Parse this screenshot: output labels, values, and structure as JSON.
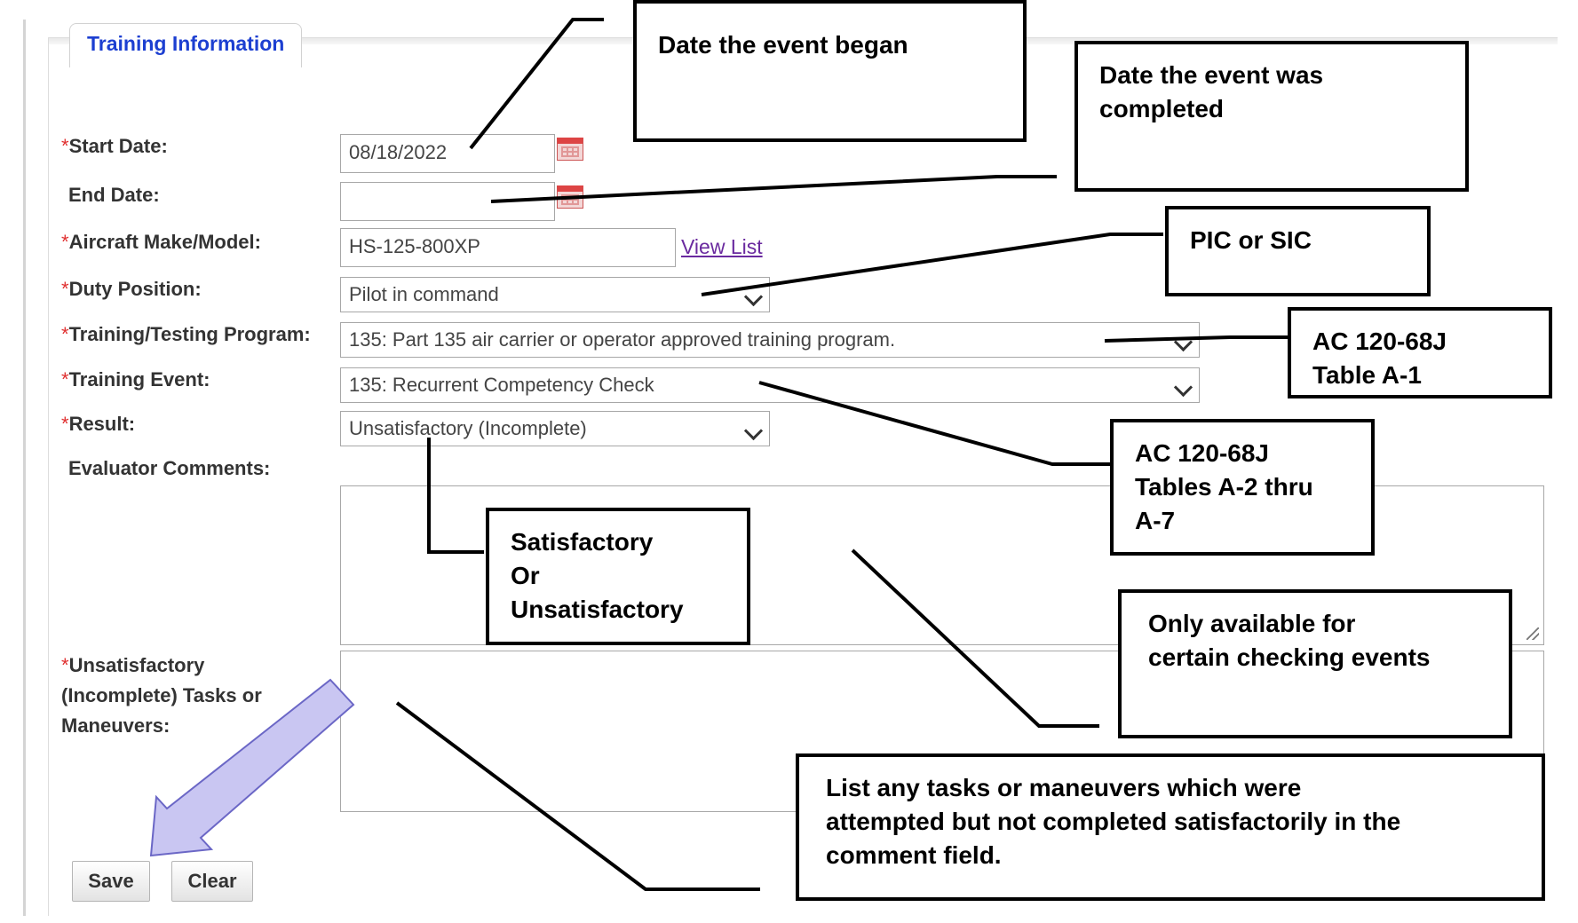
{
  "section": {
    "legend": "Training Information"
  },
  "form": {
    "start_date": {
      "label": "Start Date:",
      "required": true,
      "value": "08/18/2022"
    },
    "end_date": {
      "label": "End Date:",
      "required": false,
      "value": ""
    },
    "aircraft": {
      "label": "Aircraft Make/Model:",
      "required": true,
      "value": "HS-125-800XP",
      "link": "View List"
    },
    "duty_position": {
      "label": "Duty Position:",
      "required": true,
      "value": "Pilot in command"
    },
    "program": {
      "label": "Training/Testing Program:",
      "required": true,
      "value": "135: Part 135 air carrier or operator approved training program."
    },
    "event": {
      "label": "Training Event:",
      "required": true,
      "value": "135: Recurrent Competency Check"
    },
    "result": {
      "label": "Result:",
      "required": true,
      "value": "Unsatisfactory (Incomplete)"
    },
    "comments": {
      "label": "Evaluator Comments:",
      "required": false,
      "value": ""
    },
    "unsat_tasks": {
      "label": "Unsatisfactory (Incomplete) Tasks or Maneuvers:",
      "required": true,
      "value": ""
    },
    "required_marker": "*"
  },
  "buttons": {
    "save": "Save",
    "clear": "Clear"
  },
  "callouts": {
    "start_date": "Date the event began",
    "end_date": "Date the event was completed",
    "duty_position": "PIC or SIC",
    "program": "AC 120-68J\nTable A-1",
    "event": "AC 120-68J\nTables A-2 thru\nA-7",
    "result": "Satisfactory\nOr\nUnsatisfactory",
    "comments": "Only available for\ncertain checking events",
    "unsat_tasks": "List any tasks or maneuvers which were\nattempted but not completed satisfactorily in the\ncomment field."
  },
  "colors": {
    "legend_text": "#1c3fd1",
    "required_marker": "#e03030",
    "link": "#6a2a9f",
    "arrow_fill": "#c9c6f2",
    "arrow_stroke": "#6b67c6"
  },
  "icons": [
    "calendar-icon",
    "chevron-down-icon",
    "resize-grip-icon",
    "arrow-icon"
  ]
}
